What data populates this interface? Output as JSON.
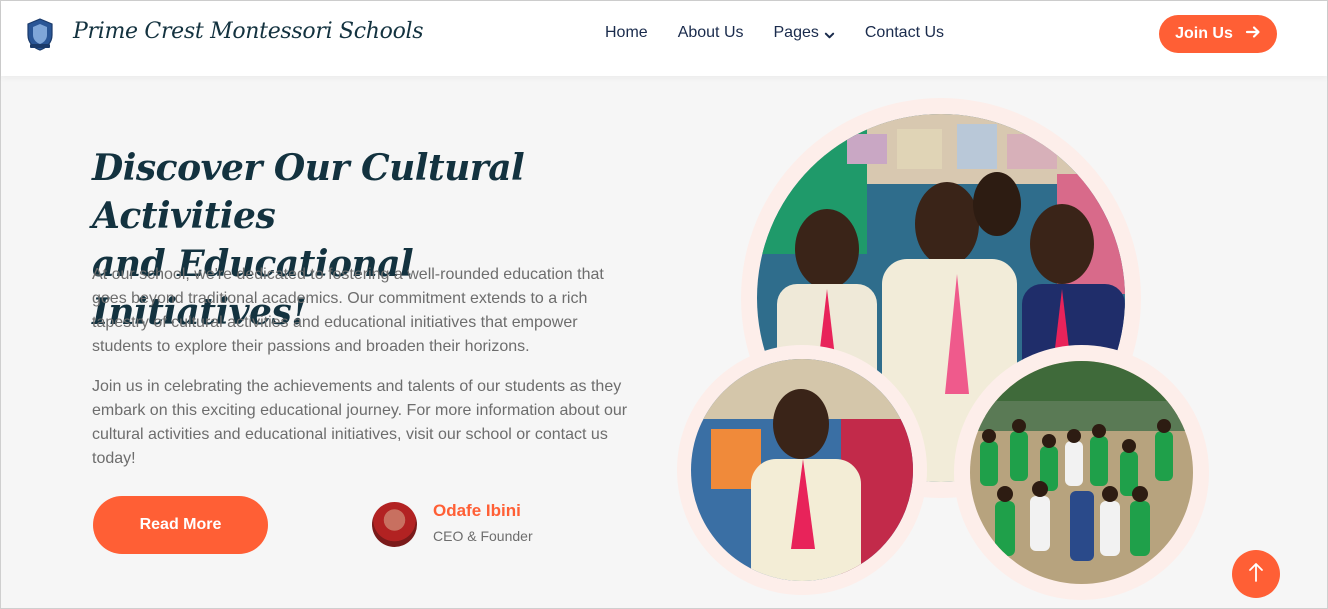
{
  "brand": {
    "name": "Prime Crest Montessori Schools",
    "logo_icon": "crest-icon"
  },
  "nav": {
    "items": [
      {
        "label": "Home"
      },
      {
        "label": "About Us"
      },
      {
        "label": "Pages",
        "icon": "chevron-down-icon"
      },
      {
        "label": "Contact Us"
      }
    ],
    "join_label": "Join Us",
    "join_icon": "arrow-right-icon"
  },
  "hero": {
    "title_line1": "Discover Our Cultural Activities",
    "title_line2": "and Educational Initiatives!",
    "paragraph1": "At our school, we're dedicated to fostering a well-rounded education that goes beyond traditional academics. Our commitment extends to a rich tapestry of cultural activities and educational initiatives that empower students to explore their passions and broaden their horizons.",
    "paragraph2": "Join us in celebrating the achievements and talents of our students as they embark on this exciting educational journey. For more information about our cultural activities and educational initiatives, visit our school or contact us today!",
    "read_more_label": "Read More"
  },
  "founder": {
    "name": "Odafe Ibini",
    "role": "CEO & Founder"
  },
  "photos": {
    "big": "students-group-photo",
    "left": "student-portrait-photo",
    "right": "students-outdoor-photo"
  },
  "colors": {
    "accent": "#ff5f35",
    "heading": "#13323f",
    "body_text": "#6d6d6d",
    "ring": "#fdeeea"
  },
  "scroll_top_icon": "arrow-up-icon"
}
